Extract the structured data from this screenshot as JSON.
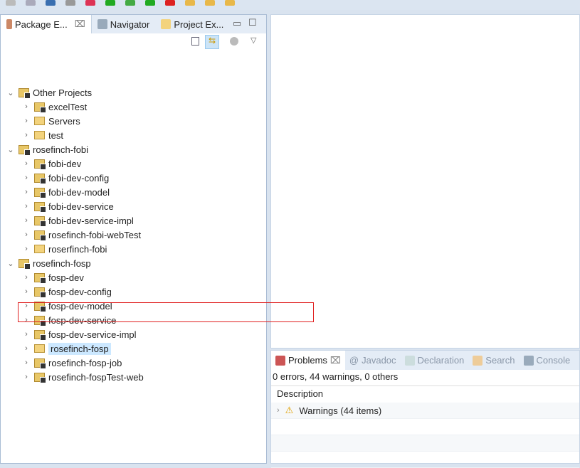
{
  "left_panel": {
    "tabs": [
      {
        "label": "Package E...",
        "close": "⌧"
      },
      {
        "label": "Navigator"
      },
      {
        "label": "Project Ex..."
      }
    ],
    "tree": [
      {
        "label": "Other Projects",
        "level": 0,
        "expanded": true,
        "type": "working-set"
      },
      {
        "label": "excelTest",
        "level": 1,
        "type": "project"
      },
      {
        "label": "Servers",
        "level": 1,
        "type": "folder"
      },
      {
        "label": "test",
        "level": 1,
        "type": "folder"
      },
      {
        "label": "rosefinch-fobi",
        "level": 0,
        "expanded": true,
        "type": "working-set"
      },
      {
        "label": "fobi-dev",
        "level": 1,
        "type": "project"
      },
      {
        "label": "fobi-dev-config",
        "level": 1,
        "type": "project"
      },
      {
        "label": "fobi-dev-model",
        "level": 1,
        "type": "project"
      },
      {
        "label": "fobi-dev-service",
        "level": 1,
        "type": "project"
      },
      {
        "label": "fobi-dev-service-impl",
        "level": 1,
        "type": "project"
      },
      {
        "label": "rosefinch-fobi-webTest",
        "level": 1,
        "type": "project"
      },
      {
        "label": "roserfinch-fobi",
        "level": 1,
        "type": "folder"
      },
      {
        "label": "rosefinch-fosp",
        "level": 0,
        "expanded": true,
        "type": "working-set"
      },
      {
        "label": "fosp-dev",
        "level": 1,
        "type": "project"
      },
      {
        "label": "fosp-dev-config",
        "level": 1,
        "type": "project"
      },
      {
        "label": "fosp-dev-model",
        "level": 1,
        "type": "project"
      },
      {
        "label": "fosp-dev-service",
        "level": 1,
        "type": "project"
      },
      {
        "label": "fosp-dev-service-impl",
        "level": 1,
        "type": "project"
      },
      {
        "label": "rosefinch-fosp",
        "level": 1,
        "type": "folder",
        "selected": true
      },
      {
        "label": "rosefinch-fosp-job",
        "level": 1,
        "type": "project"
      },
      {
        "label": "rosefinch-fospTest-web",
        "level": 1,
        "type": "project"
      }
    ]
  },
  "bottom_panel": {
    "tabs": [
      "Problems",
      "Javadoc",
      "Declaration",
      "Search",
      "Console"
    ],
    "summary": "0 errors, 44 warnings, 0 others",
    "column": "Description",
    "group": "Warnings (44 items)"
  },
  "colors": {
    "selection": "#cce8ff",
    "annotation": "#e02020"
  }
}
